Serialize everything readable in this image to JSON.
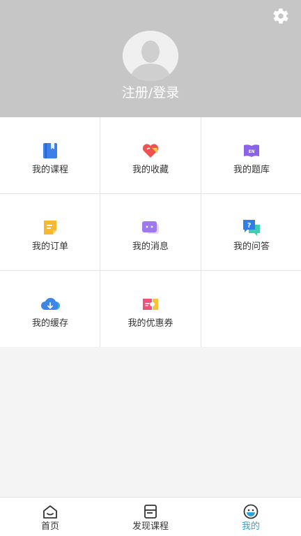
{
  "header": {
    "login_label": "注册/登录",
    "settings_icon": "gear-icon",
    "avatar_icon": "default-avatar-icon",
    "background_color": "#c6c6c6"
  },
  "menu": {
    "items": [
      {
        "label": "我的课程",
        "icon": "course-book-icon",
        "color": "#3d7fe8"
      },
      {
        "label": "我的收藏",
        "icon": "favorite-heart-icon",
        "color": "#f0524f"
      },
      {
        "label": "我的题库",
        "icon": "question-bank-icon",
        "color": "#8b63e8"
      },
      {
        "label": "我的订单",
        "icon": "order-note-icon",
        "color": "#f5b82e"
      },
      {
        "label": "我的消息",
        "icon": "message-bubble-icon",
        "color": "#9d78ee"
      },
      {
        "label": "我的问答",
        "icon": "qa-bubble-icon",
        "color": "#2f7de8"
      },
      {
        "label": "我的缓存",
        "icon": "cloud-download-icon",
        "color": "#3d86e8"
      },
      {
        "label": "我的优惠券",
        "icon": "coupon-ticket-icon",
        "color": "#f25277"
      }
    ]
  },
  "tabbar": {
    "active_color": "#2fa3d8",
    "tabs": [
      {
        "label": "首页",
        "icon": "home-icon"
      },
      {
        "label": "发现课程",
        "icon": "discover-course-icon"
      },
      {
        "label": "我的",
        "icon": "profile-face-icon",
        "active": true
      }
    ]
  }
}
